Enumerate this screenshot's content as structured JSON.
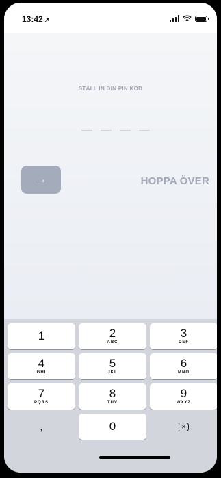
{
  "status_bar": {
    "time": "13:42",
    "location_icon": "location-arrow-icon"
  },
  "pin_setup": {
    "title": "STÄLL IN DIN PIN KOD",
    "next_icon": "→",
    "skip_label": "HOPPA ÖVER"
  },
  "keypad": {
    "keys": [
      {
        "num": "1",
        "letters": ""
      },
      {
        "num": "2",
        "letters": "ABC"
      },
      {
        "num": "3",
        "letters": "DEF"
      },
      {
        "num": "4",
        "letters": "GHI"
      },
      {
        "num": "5",
        "letters": "JKL"
      },
      {
        "num": "6",
        "letters": "MNO"
      },
      {
        "num": "7",
        "letters": "PQRS"
      },
      {
        "num": "8",
        "letters": "TUV"
      },
      {
        "num": "9",
        "letters": "WXYZ"
      },
      {
        "num": ",",
        "letters": ""
      },
      {
        "num": "0",
        "letters": ""
      },
      {
        "num": "⌫",
        "letters": ""
      }
    ]
  }
}
